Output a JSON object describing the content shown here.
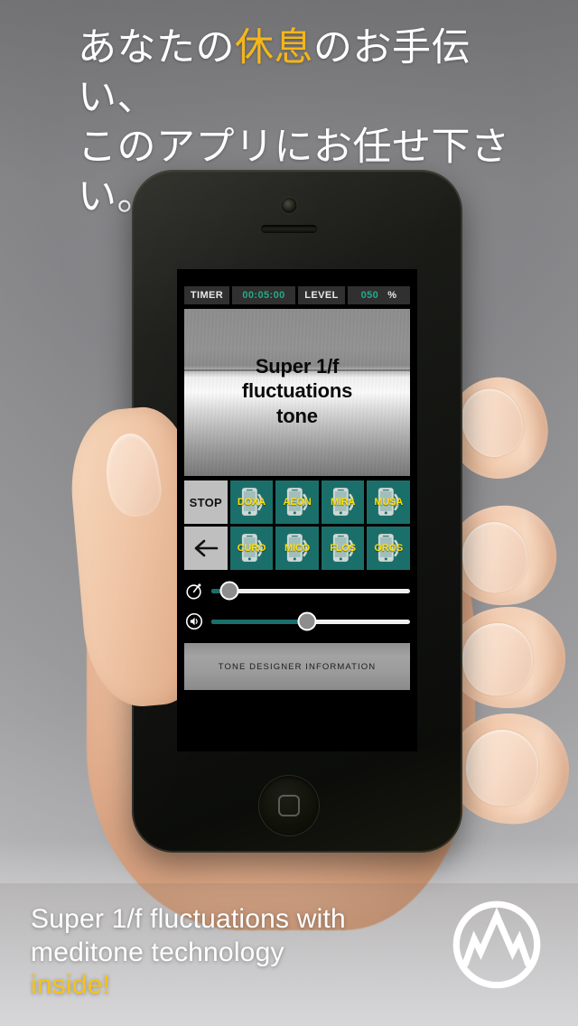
{
  "headline": {
    "line1_a": "あなたの",
    "line1_highlight": "休息",
    "line1_b": "のお手伝い、",
    "line2": "このアプリにお任せ下さい。",
    "highlight_color": "#f5b61a"
  },
  "app": {
    "statusbar": {
      "timer_label": "TIMER",
      "timer_value": "00:05:00",
      "level_label": "LEVEL",
      "level_value": "050",
      "level_unit": "%",
      "value_color": "#25a98a"
    },
    "artwork": {
      "title_line1": "Super 1/f",
      "title_line2": "fluctuations",
      "title_line3": "tone"
    },
    "buttons": {
      "stop_label": "STOP",
      "back_label": "back-arrow",
      "tones": [
        {
          "label": "DOXA",
          "icon": "phone-sound-icon"
        },
        {
          "label": "AEON",
          "icon": "phone-sound-icon"
        },
        {
          "label": "MIRA",
          "icon": "phone-sound-icon"
        },
        {
          "label": "MUSA",
          "icon": "phone-sound-icon"
        },
        {
          "label": "CURO",
          "icon": "phone-sound-icon"
        },
        {
          "label": "MICO",
          "icon": "phone-sound-icon"
        },
        {
          "label": "FLOS",
          "icon": "phone-sound-icon"
        },
        {
          "label": "OROS",
          "icon": "phone-sound-icon"
        }
      ],
      "tile_color": "#1b6f6a",
      "label_color": "#ffe000"
    },
    "sliders": [
      {
        "name": "timer-slider",
        "icon": "stopwatch-icon",
        "value": 9
      },
      {
        "name": "volume-slider",
        "icon": "speaker-icon",
        "value": 48
      }
    ],
    "info_banner": "TONE DESIGNER INFORMATION"
  },
  "caption": {
    "line1": "Super 1/f fluctuations with",
    "line2": "meditone technology",
    "line3_highlight": "inside!",
    "highlight_color": "#f5c21a",
    "logo": "meditone-circle-logo"
  }
}
